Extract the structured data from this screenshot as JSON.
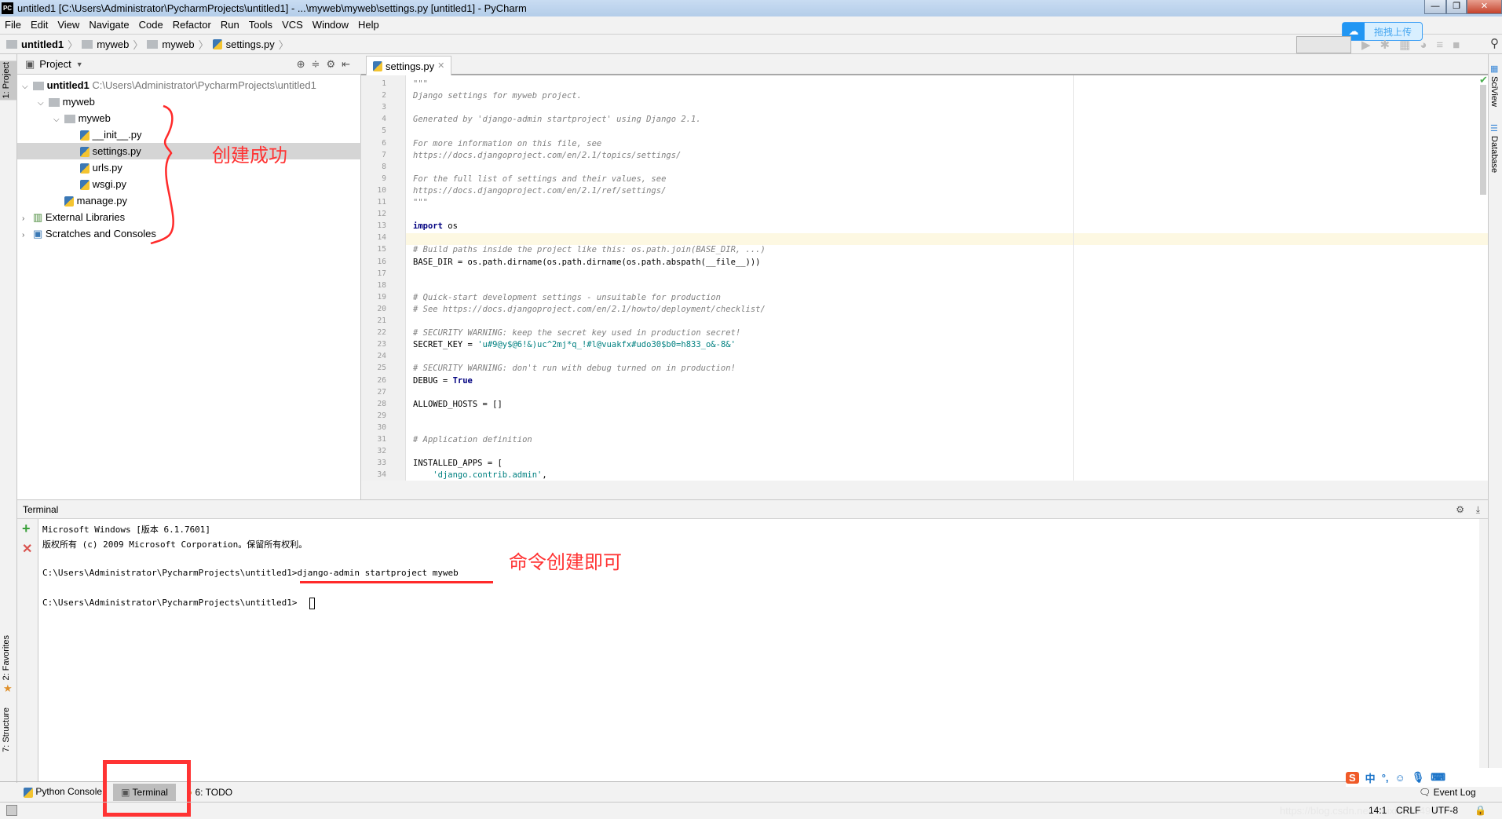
{
  "window": {
    "title": "untitled1 [C:\\Users\\Administrator\\PycharmProjects\\untitled1] - ...\\myweb\\myweb\\settings.py [untitled1] - PyCharm",
    "logo": "PC"
  },
  "menu": [
    "File",
    "Edit",
    "View",
    "Navigate",
    "Code",
    "Refactor",
    "Run",
    "Tools",
    "VCS",
    "Window",
    "Help"
  ],
  "breadcrumb": [
    "untitled1",
    "myweb",
    "myweb",
    "settings.py"
  ],
  "upload_widget": {
    "label": "拖拽上传"
  },
  "left_tools": {
    "project": "1: Project",
    "favorites": "2: Favorites",
    "structure": "7: Structure"
  },
  "right_tools": {
    "sciview": "SciView",
    "database": "Database"
  },
  "project_panel": {
    "title": "Project",
    "tree": [
      {
        "label": "untitled1",
        "path": "C:\\Users\\Administrator\\PycharmProjects\\untitled1",
        "level": 0,
        "type": "folder",
        "expanded": true,
        "bold": true
      },
      {
        "label": "myweb",
        "level": 1,
        "type": "folder",
        "expanded": true
      },
      {
        "label": "myweb",
        "level": 2,
        "type": "folder",
        "expanded": true
      },
      {
        "label": "__init__.py",
        "level": 3,
        "type": "py"
      },
      {
        "label": "settings.py",
        "level": 3,
        "type": "py",
        "selected": true
      },
      {
        "label": "urls.py",
        "level": 3,
        "type": "py"
      },
      {
        "label": "wsgi.py",
        "level": 3,
        "type": "py"
      },
      {
        "label": "manage.py",
        "level": 2,
        "type": "py"
      },
      {
        "label": "External Libraries",
        "level": 0,
        "type": "lib",
        "expanded": false
      },
      {
        "label": "Scratches and Consoles",
        "level": 0,
        "type": "scratch",
        "expanded": false
      }
    ]
  },
  "annotations": {
    "tree": "创建成功",
    "terminal": "命令创建即可",
    "color": "#ff3333"
  },
  "editor": {
    "tab": "settings.py",
    "current_line": 14,
    "lines": [
      [
        [
          "cm",
          "\"\"\""
        ]
      ],
      [
        [
          "cm",
          "Django settings for myweb project."
        ]
      ],
      [],
      [
        [
          "cm",
          "Generated by 'django-admin startproject' using Django 2.1."
        ]
      ],
      [],
      [
        [
          "cm",
          "For more information on this file, see"
        ]
      ],
      [
        [
          "cm",
          "https://docs.djangoproject.com/en/2.1/topics/settings/"
        ]
      ],
      [],
      [
        [
          "cm",
          "For the full list of settings and their values, see"
        ]
      ],
      [
        [
          "cm",
          "https://docs.djangoproject.com/en/2.1/ref/settings/"
        ]
      ],
      [
        [
          "cm",
          "\"\"\""
        ]
      ],
      [],
      [
        [
          "kw",
          "import"
        ],
        [
          "",
          "os"
        ]
      ],
      [],
      [
        [
          "cm",
          "# Build paths inside the project like this: os.path.join(BASE_DIR, ...)"
        ]
      ],
      [
        [
          "",
          "BASE_DIR = os.path.dirname(os.path.dirname(os.path.abspath(__file__)))"
        ]
      ],
      [],
      [],
      [
        [
          "cm",
          "# Quick-start development settings - unsuitable for production"
        ]
      ],
      [
        [
          "cm",
          "# See https://docs.djangoproject.com/en/2.1/howto/deployment/checklist/"
        ]
      ],
      [],
      [
        [
          "cm",
          "# SECURITY WARNING: keep the secret key used in production secret!"
        ]
      ],
      [
        [
          "",
          "SECRET_KEY = "
        ],
        [
          "st",
          "'u#9@y$@6!&)uc^2mj*q_!#l@vuakfx#udo30$b0=h833_o&-8&'"
        ]
      ],
      [],
      [
        [
          "cm",
          "# SECURITY WARNING: don't run with debug turned on in production!"
        ]
      ],
      [
        [
          "",
          "DEBUG = "
        ],
        [
          "kw",
          "True"
        ]
      ],
      [],
      [
        [
          "",
          "ALLOWED_HOSTS = []"
        ]
      ],
      [],
      [],
      [
        [
          "cm",
          "# Application definition"
        ]
      ],
      [],
      [
        [
          "",
          "INSTALLED_APPS = ["
        ]
      ],
      [
        [
          "",
          "    "
        ],
        [
          "st",
          "'django.contrib.admin'"
        ],
        [
          "",
          ","
        ]
      ]
    ]
  },
  "terminal": {
    "title": "Terminal",
    "lines": [
      "Microsoft Windows [版本 6.1.7601]",
      "版权所有 (c) 2009 Microsoft Corporation。保留所有权利。",
      "",
      "C:\\Users\\Administrator\\PycharmProjects\\untitled1>django-admin startproject myweb",
      "",
      "C:\\Users\\Administrator\\PycharmProjects\\untitled1>"
    ]
  },
  "bottom_tabs": [
    {
      "label": "Python Console"
    },
    {
      "label": "Terminal",
      "active": true
    },
    {
      "label": "6: TODO"
    }
  ],
  "status": {
    "position": "14:1",
    "line_sep": "CRLF",
    "encoding": "UTF-8",
    "event_log": "Event Log",
    "watermark": "https://blog.csdn.net/weixin_43495473"
  }
}
